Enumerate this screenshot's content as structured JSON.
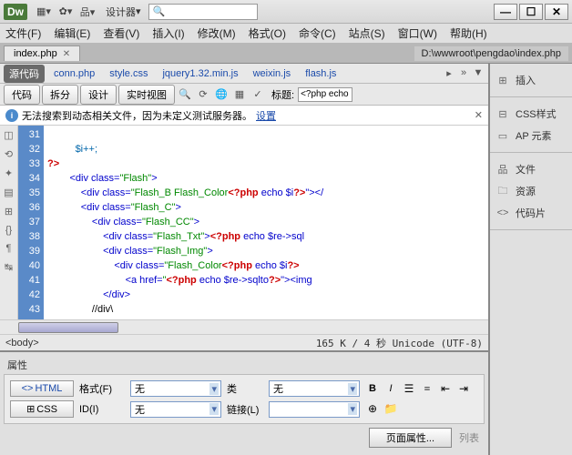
{
  "app": {
    "logo": "Dw",
    "workspace": "设计器",
    "search_placeholder": ""
  },
  "menus": [
    "文件(F)",
    "编辑(E)",
    "查看(V)",
    "插入(I)",
    "修改(M)",
    "格式(O)",
    "命令(C)",
    "站点(S)",
    "窗口(W)",
    "帮助(H)"
  ],
  "tab": {
    "name": "index.php",
    "path": "D:\\wwwroot\\pengdao\\index.php"
  },
  "sourceTabs": {
    "active": "源代码",
    "items": [
      "conn.php",
      "style.css",
      "jquery1.32.min.js",
      "weixin.js",
      "flash.js"
    ]
  },
  "viewBtns": [
    "代码",
    "拆分",
    "设计",
    "实时视图"
  ],
  "titleLabel": "标题:",
  "titleValue": "<?php echo",
  "notice": {
    "text": "无法搜索到动态相关文件，因为未定义测试服务器。",
    "link": "设置"
  },
  "lines": [
    31,
    32,
    33,
    34,
    35,
    36,
    37,
    38,
    39,
    40,
    41,
    42,
    43
  ],
  "status": {
    "left": "<body>",
    "right": "165 K / 4 秒 Unicode (UTF-8)"
  },
  "props": {
    "title": "属性",
    "htmlBtn": "HTML",
    "cssBtn": "CSS",
    "formatLbl": "格式(F)",
    "formatVal": "无",
    "classLbl": "类",
    "classVal": "无",
    "idLbl": "ID(I)",
    "idVal": "无",
    "linkLbl": "链接(L)",
    "linkVal": "",
    "pageProps": "页面属性...",
    "listItems": "列表"
  },
  "rightPanel": {
    "insert": "插入",
    "cssStyles": "CSS样式",
    "apElems": "AP 元素",
    "files": "文件",
    "assets": "资源",
    "snippets": "代码片"
  },
  "code": {
    "l32": "$i++;",
    "l33": "?>",
    "l34a": "<div class=",
    "l34b": "\"Flash\"",
    "l34c": ">",
    "l35a": "<div class=",
    "l35b": "\"Flash_B Flash_Color",
    "l35p": "<?php",
    "l35e": " echo $i",
    "l35q": "?>",
    "l35c": "\"></",
    "l36a": "<div class=",
    "l36b": "\"Flash_C\"",
    "l36c": ">",
    "l37a": "<div class=",
    "l37b": "\"Flash_CC\"",
    "l37c": ">",
    "l38a": "<div class=",
    "l38b": "\"Flash_Txt\"",
    "l38c": ">",
    "l38p": "<?php",
    "l38e": " echo $re->sql",
    "l39a": "<div class=",
    "l39b": "\"Flash_Img\"",
    "l39c": ">",
    "l40a": "<div class=",
    "l40b": "\"Flash_Color",
    "l40p": "<?php",
    "l40e": " echo $i",
    "l40q": "?>",
    "l41a": "<a href=",
    "l41b": "\"",
    "l41p": "<?php",
    "l41e": " echo $re->sqlto",
    "l41q": "?>",
    "l41c": "\"><img",
    "l42": "</div>",
    "l43": "//div\\"
  }
}
